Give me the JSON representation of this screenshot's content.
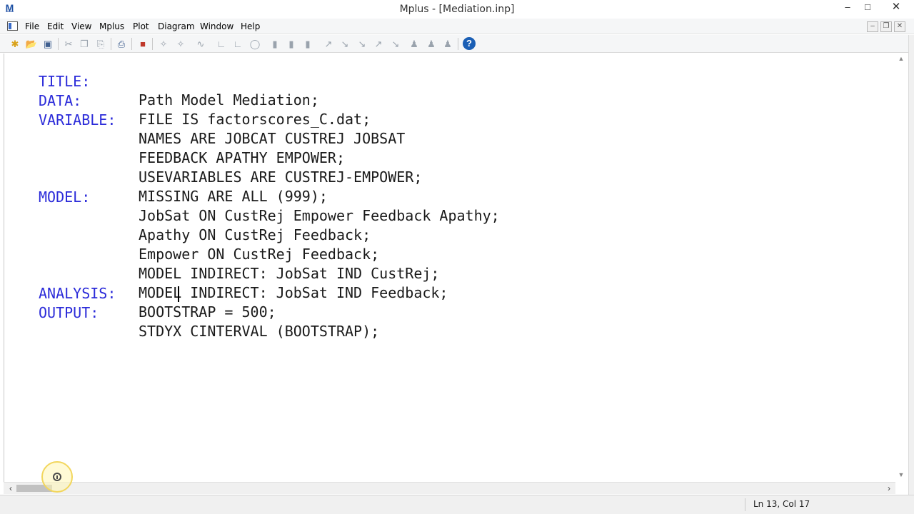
{
  "window": {
    "title": "Mplus - [Mediation.inp]",
    "minimize": "–",
    "maximize": "□",
    "close": "✕"
  },
  "menu": {
    "items": [
      {
        "label": "File"
      },
      {
        "label": "Edit"
      },
      {
        "label": "View"
      },
      {
        "label": "Mplus"
      },
      {
        "label": "Plot"
      },
      {
        "label": "Diagram"
      },
      {
        "label": "Window"
      },
      {
        "label": "Help"
      }
    ],
    "mdi_minimize": "–",
    "mdi_restore": "❐",
    "mdi_close": "✕"
  },
  "toolbar": {
    "help": "?"
  },
  "editor": {
    "lines": [
      {
        "keyword": "TITLE:",
        "statement": "Path Model Mediation;"
      },
      {
        "keyword": "DATA:",
        "statement": "FILE IS factorscores_C.dat;"
      },
      {
        "keyword": "VARIABLE:",
        "statement": "NAMES ARE JOBCAT CUSTREJ JOBSAT"
      },
      {
        "keyword": "",
        "statement": "FEEDBACK APATHY EMPOWER;"
      },
      {
        "keyword": "",
        "statement": "USEVARIABLES ARE CUSTREJ-EMPOWER;"
      },
      {
        "keyword": "",
        "statement": "MISSING ARE ALL (999);"
      },
      {
        "keyword": "MODEL:",
        "statement": "JobSat ON CustRej Empower Feedback Apathy;"
      },
      {
        "keyword": "",
        "statement": "Apathy ON CustRej Feedback;"
      },
      {
        "keyword": "",
        "statement": "Empower ON CustRej Feedback;"
      },
      {
        "keyword": "",
        "statement": "MODEL INDIRECT: JobSat IND CustRej;"
      },
      {
        "keyword": "",
        "statement": "MODEL INDIRECT: JobSat IND Feedback;"
      },
      {
        "keyword": "ANALYSIS:",
        "statement": "BOOTSTRAP = 500;"
      },
      {
        "keyword": "OUTPUT:",
        "statement": "STDYX CINTERVAL (BOOTSTRAP);"
      }
    ]
  },
  "statusbar": {
    "position": "Ln 13, Col 17"
  },
  "colors": {
    "keyword": "#2b2bd9",
    "text": "#1a1a1a",
    "help_button": "#1b5fb5"
  }
}
